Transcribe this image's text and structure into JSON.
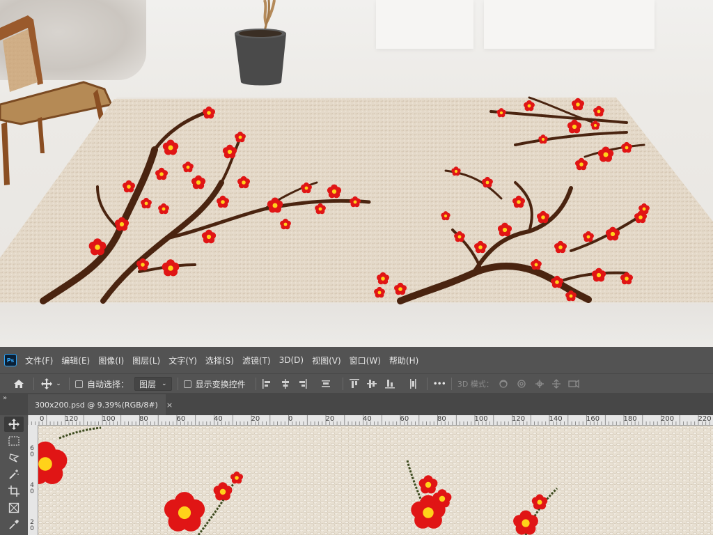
{
  "menubar": {
    "logo": "Ps",
    "items": [
      "文件(F)",
      "编辑(E)",
      "图像(I)",
      "图层(L)",
      "文字(Y)",
      "选择(S)",
      "滤镜(T)",
      "3D(D)",
      "视图(V)",
      "窗口(W)",
      "帮助(H)"
    ]
  },
  "options": {
    "auto_select_label": "自动选择：",
    "auto_select_value": "图层",
    "show_transform_label": "显示变换控件",
    "mode_3d_label": "3D 模式：",
    "more_label": "•••"
  },
  "document": {
    "panel_toggle": "»",
    "tab_title": "300x200.psd @ 9.39%(RGB/8#)",
    "close_label": "×"
  },
  "ruler": {
    "top_labels": [
      "0",
      "120",
      "100",
      "80",
      "60",
      "40",
      "20",
      "0",
      "20",
      "40",
      "60",
      "80",
      "100",
      "120",
      "140",
      "160",
      "180",
      "200",
      "220"
    ],
    "left_labels": [
      "6\n0",
      "4\n0",
      "2\n0"
    ]
  },
  "icons": {
    "home": "home-icon",
    "move": "move-icon",
    "marquee": "marquee-icon",
    "lasso": "lasso-icon",
    "magic_wand": "magic-wand-icon",
    "crop": "crop-icon",
    "slice": "frame-icon",
    "eyedropper": "eyedropper-icon"
  },
  "colors": {
    "ps_panel": "#535353",
    "ps_dark": "#474747",
    "ps_accent": "#2fa3f5",
    "rug_base": "#e3d8c8",
    "blossom_red": "#e01515",
    "blossom_center": "#ffd21a",
    "branch": "#4a2410"
  }
}
